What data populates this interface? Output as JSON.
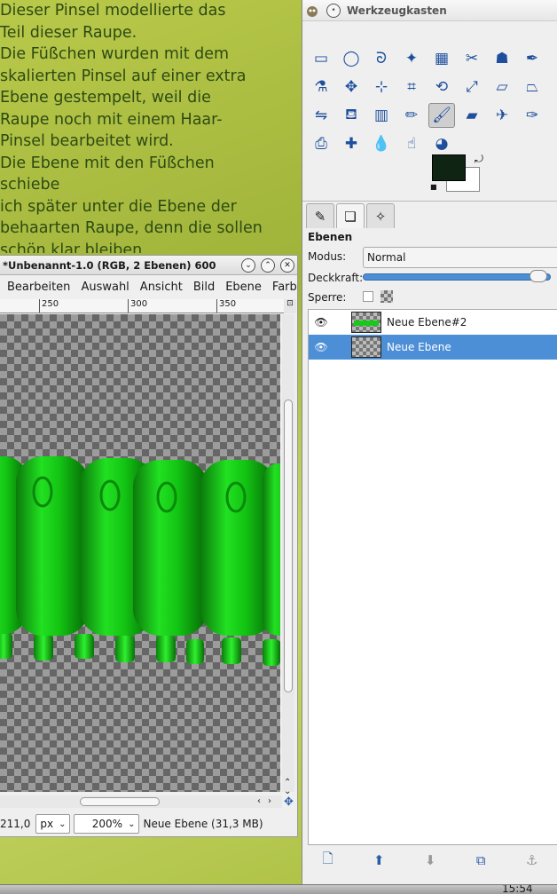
{
  "tutorial": {
    "lines": [
      "Dieser Pinsel modellierte das",
      "Teil dieser Raupe.",
      "Die Füßchen wurden mit dem",
      "skalierten Pinsel auf einer extra",
      "Ebene gestempelt, weil die",
      "Raupe noch  mit einem Haar-",
      "Pinsel bearbeitet wird.",
      "Die Ebene mit den Füßchen",
      "schiebe",
      "ich später unter die Ebene der",
      "behaarten Raupe, denn die sollen",
      "schön klar bleiben"
    ]
  },
  "image_window": {
    "title": "*Unbenannt-1.0 (RGB, 2 Ebenen) 600",
    "menu": [
      "Bearbeiten",
      "Auswahl",
      "Ansicht",
      "Bild",
      "Ebene",
      "Farb"
    ],
    "ruler_ticks": [
      "250",
      "300",
      "350"
    ],
    "status": {
      "coord": "211,0",
      "unit": "px",
      "zoom": "200%",
      "info": "Neue Ebene (31,3 MB)"
    }
  },
  "toolbox": {
    "title": "Werkzeugkasten",
    "tools": [
      {
        "name": "rect-select-icon",
        "glyph": "▭"
      },
      {
        "name": "ellipse-select-icon",
        "glyph": "◯"
      },
      {
        "name": "free-select-icon",
        "glyph": "ᘐ"
      },
      {
        "name": "fuzzy-select-icon",
        "glyph": "✦"
      },
      {
        "name": "color-select-icon",
        "glyph": "▦"
      },
      {
        "name": "scissors-icon",
        "glyph": "✂"
      },
      {
        "name": "foreground-select-icon",
        "glyph": "☗"
      },
      {
        "name": "paths-icon",
        "glyph": "✒"
      },
      {
        "name": "color-picker-icon",
        "glyph": "⚗"
      },
      {
        "name": "move-icon",
        "glyph": "✥"
      },
      {
        "name": "align-icon",
        "glyph": "⊹"
      },
      {
        "name": "crop-icon",
        "glyph": "⌗"
      },
      {
        "name": "rotate-icon",
        "glyph": "⟲"
      },
      {
        "name": "scale-icon",
        "glyph": "⤢"
      },
      {
        "name": "shear-icon",
        "glyph": "▱"
      },
      {
        "name": "perspective-icon",
        "glyph": "⏢"
      },
      {
        "name": "flip-icon",
        "glyph": "⇋"
      },
      {
        "name": "bucket-fill-icon",
        "glyph": "⛾"
      },
      {
        "name": "gradient-icon",
        "glyph": "▥"
      },
      {
        "name": "pencil-icon",
        "glyph": "✏"
      },
      {
        "name": "paintbrush-icon",
        "glyph": "🖌"
      },
      {
        "name": "eraser-icon",
        "glyph": "▰"
      },
      {
        "name": "airbrush-icon",
        "glyph": "✈"
      },
      {
        "name": "ink-icon",
        "glyph": "✑"
      },
      {
        "name": "clone-icon",
        "glyph": "⎙"
      },
      {
        "name": "heal-icon",
        "glyph": "✚"
      },
      {
        "name": "blur-icon",
        "glyph": "💧"
      },
      {
        "name": "smudge-icon",
        "glyph": "☝"
      },
      {
        "name": "dodge-burn-icon",
        "glyph": "◕"
      }
    ],
    "active_tool_index": 20,
    "colors": {
      "foreground": "#0f2412",
      "background": "#ffffff"
    }
  },
  "layers": {
    "heading": "Ebenen",
    "mode_label": "Modus:",
    "mode_value": "Normal",
    "opacity_label": "Deckkraft:",
    "lock_label": "Sperre:",
    "items": [
      {
        "name": "Neue Ebene#2",
        "selected": false
      },
      {
        "name": "Neue Ebene",
        "selected": true
      }
    ]
  },
  "taskbar": {
    "clock": "15:54"
  }
}
